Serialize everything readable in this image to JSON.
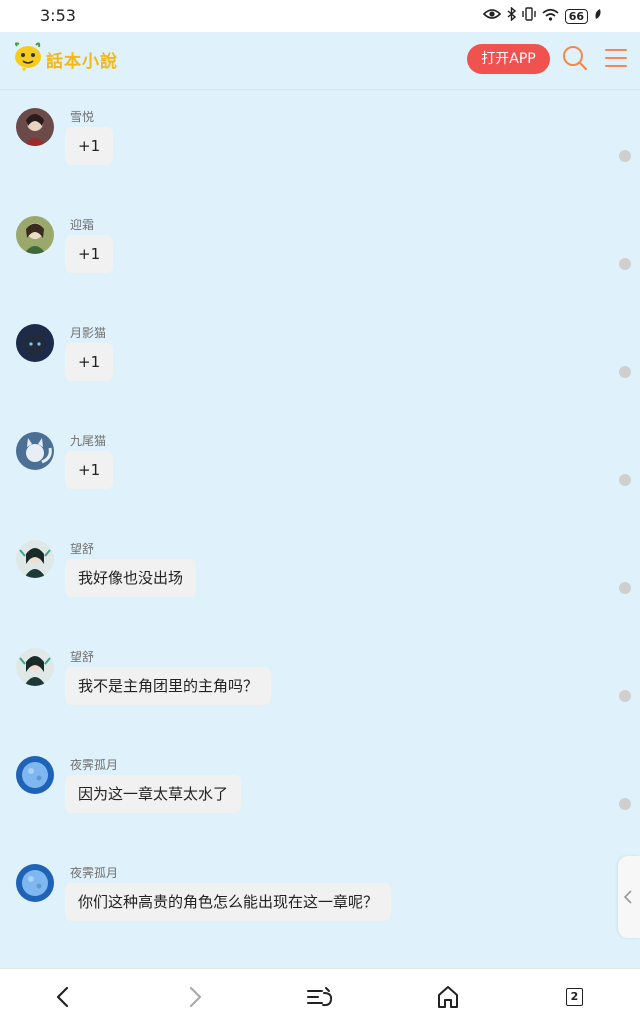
{
  "status_bar": {
    "time": "3:53",
    "battery": "66"
  },
  "header": {
    "logo_text": "話本小說",
    "open_app_label": "打开APP"
  },
  "messages": [
    {
      "user": "雪悦",
      "text": "+1"
    },
    {
      "user": "迎霜",
      "text": "+1"
    },
    {
      "user": "月影猫",
      "text": "+1"
    },
    {
      "user": "九尾猫",
      "text": "+1"
    },
    {
      "user": "望舒",
      "text": "我好像也没出场"
    },
    {
      "user": "望舒",
      "text": "我不是主角团里的主角吗？"
    },
    {
      "user": "夜霁孤月",
      "text": "因为这一章太草太水了"
    },
    {
      "user": "夜霁孤月",
      "text": "你们这种高贵的角色怎么能出现在这一章呢？"
    }
  ],
  "bottom_nav": {
    "tabs_count": "2"
  },
  "colors": {
    "background": "#dff2fc",
    "accent": "#f0534f",
    "logo": "#f2b817",
    "bubble": "#f1f1f1"
  }
}
